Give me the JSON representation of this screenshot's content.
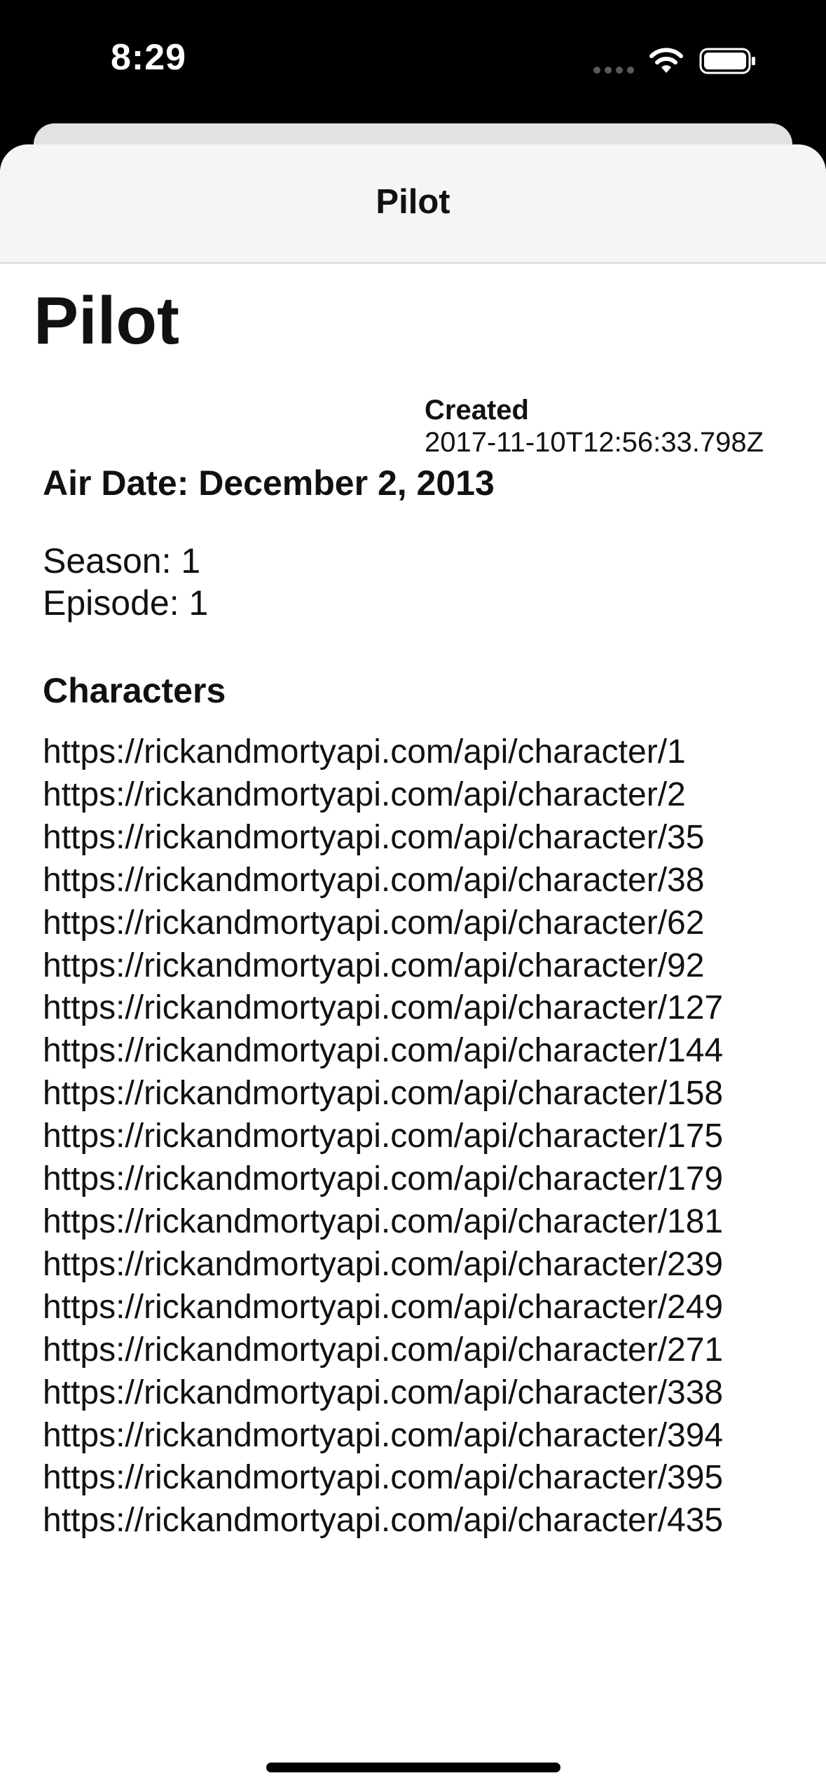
{
  "status_bar": {
    "time": "8:29"
  },
  "nav": {
    "title": "Pilot"
  },
  "episode": {
    "title": "Pilot",
    "created_label": "Created",
    "created_value": "2017-11-10T12:56:33.798Z",
    "air_date": "Air Date: December 2, 2013",
    "season": "Season: 1",
    "episode": "Episode: 1"
  },
  "characters": {
    "heading": "Characters",
    "urls": [
      "https://rickandmortyapi.com/api/character/1",
      "https://rickandmortyapi.com/api/character/2",
      "https://rickandmortyapi.com/api/character/35",
      "https://rickandmortyapi.com/api/character/38",
      "https://rickandmortyapi.com/api/character/62",
      "https://rickandmortyapi.com/api/character/92",
      "https://rickandmortyapi.com/api/character/127",
      "https://rickandmortyapi.com/api/character/144",
      "https://rickandmortyapi.com/api/character/158",
      "https://rickandmortyapi.com/api/character/175",
      "https://rickandmortyapi.com/api/character/179",
      "https://rickandmortyapi.com/api/character/181",
      "https://rickandmortyapi.com/api/character/239",
      "https://rickandmortyapi.com/api/character/249",
      "https://rickandmortyapi.com/api/character/271",
      "https://rickandmortyapi.com/api/character/338",
      "https://rickandmortyapi.com/api/character/394",
      "https://rickandmortyapi.com/api/character/395",
      "https://rickandmortyapi.com/api/character/435"
    ]
  },
  "icons": {
    "cellular": "cellular-signal-icon",
    "wifi": "wifi-icon",
    "battery": "battery-icon"
  },
  "colors": {
    "status_bar_bg": "#000000",
    "sheet_bg": "#ffffff",
    "nav_bg": "#f5f5f5",
    "text": "#111111"
  }
}
